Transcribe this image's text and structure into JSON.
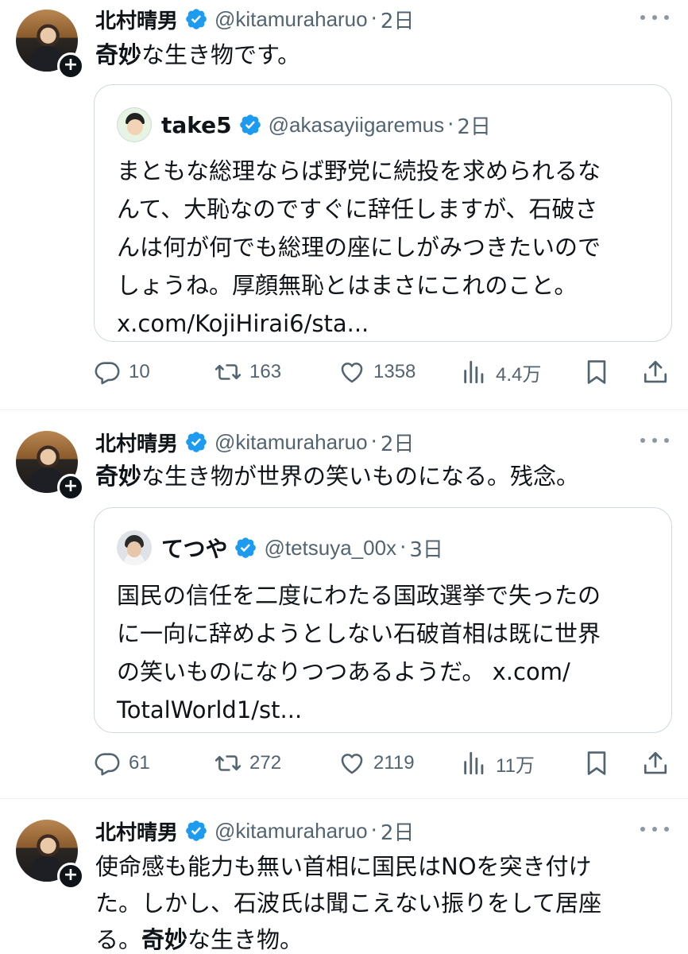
{
  "colors": {
    "text": "#0f1419",
    "secondary": "#536471",
    "verified": "#1d9bf0",
    "border": "#cfd9de"
  },
  "posts": [
    {
      "author": {
        "name": "北村晴男",
        "handle": "@kitamuraharuo",
        "time": "2日"
      },
      "text_bold": "奇妙",
      "text_rest": "な生き物です。",
      "quote": {
        "author": {
          "name": "take5",
          "handle": "@akasayiigaremus",
          "time": "2日"
        },
        "lines": [
          "まともな総理ならば野党に続投を求められるな",
          "んて、大恥なのですぐに辞任しますが、石破さ",
          "んは何が何でも総理の座にしがみつきたいので",
          "しょうね。厚顔無恥とはまさにこれのこと。",
          "x.com/KojiHirai6/sta..."
        ]
      },
      "actions": {
        "replies": "10",
        "reposts": "163",
        "likes": "1358",
        "views": "4.4万"
      }
    },
    {
      "author": {
        "name": "北村晴男",
        "handle": "@kitamuraharuo",
        "time": "2日"
      },
      "text_bold": "奇妙",
      "text_rest": "な生き物が世界の笑いものになる。残念。",
      "quote": {
        "author": {
          "name": "てつや",
          "handle": "@tetsuya_00x",
          "time": "3日"
        },
        "lines": [
          "国民の信任を二度にわたる国政選挙で失ったの",
          "に一向に辞めようとしない石破首相は既に世界",
          "の笑いものになりつつあるようだ。 x.com/",
          "TotalWorld1/st..."
        ]
      },
      "actions": {
        "replies": "61",
        "reposts": "272",
        "likes": "2119",
        "views": "11万"
      }
    },
    {
      "author": {
        "name": "北村晴男",
        "handle": "@kitamuraharuo",
        "time": "2日"
      },
      "lines": [
        "使命感も能力も無い首相に国民はNOを突き付け",
        "た。しかし、石波氏は聞こえない振りをして居座"
      ],
      "last_bold": "奇妙",
      "last_prefix": "る。",
      "last_rest": "な生き物。"
    }
  ],
  "icons": [
    "follow-plus-icon",
    "verified-badge-icon",
    "more-options-icon",
    "reply-icon",
    "repost-icon",
    "like-icon",
    "views-icon",
    "bookmark-icon",
    "share-icon"
  ]
}
